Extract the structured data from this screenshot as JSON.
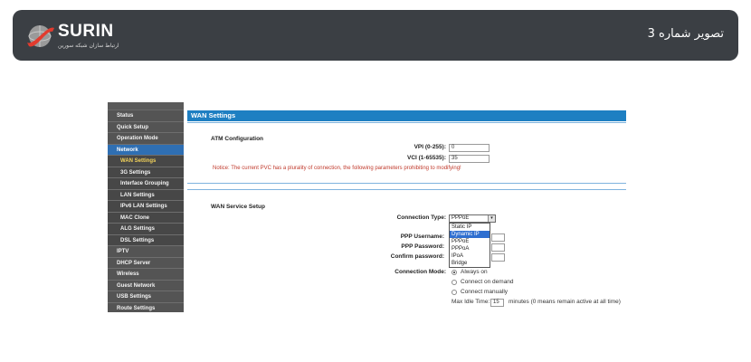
{
  "banner": {
    "brand": "SURIN",
    "tagline": "ارتباط سازان شبکه سورین",
    "title": "تصویر شماره 3"
  },
  "sidebar": {
    "items": [
      {
        "label": "Status",
        "level": "top"
      },
      {
        "label": "Quick Setup",
        "level": "top"
      },
      {
        "label": "Operation Mode",
        "level": "top"
      },
      {
        "label": "Network",
        "level": "active"
      },
      {
        "label": "WAN Settings",
        "level": "selected"
      },
      {
        "label": "3G Settings",
        "level": "sub"
      },
      {
        "label": "Interface Grouping",
        "level": "sub"
      },
      {
        "label": "LAN Settings",
        "level": "sub"
      },
      {
        "label": "IPv6 LAN Settings",
        "level": "sub"
      },
      {
        "label": "MAC Clone",
        "level": "sub"
      },
      {
        "label": "ALG Settings",
        "level": "sub"
      },
      {
        "label": "DSL Settings",
        "level": "sub"
      },
      {
        "label": "IPTV",
        "level": "top"
      },
      {
        "label": "DHCP Server",
        "level": "top"
      },
      {
        "label": "Wireless",
        "level": "top"
      },
      {
        "label": "Guest Network",
        "level": "top"
      },
      {
        "label": "USB Settings",
        "level": "top"
      },
      {
        "label": "Route Settings",
        "level": "top"
      }
    ]
  },
  "page": {
    "header": "WAN Settings",
    "atm": {
      "title": "ATM Configuration",
      "vpi_label": "VPI (0-255):",
      "vpi_value": "0",
      "vci_label": "VCI (1-65535):",
      "vci_value": "35",
      "notice": "Notice: The current PVC has a plurality of connection, the following parameters prohibiting to modifying!"
    },
    "wan": {
      "title": "WAN Service Setup",
      "conn_type_label": "Connection Type:",
      "conn_type_value": "PPPoE",
      "options": [
        "Static IP",
        "Dynamic IP",
        "PPPoE",
        "PPPoA",
        "IPoA",
        "Bridge"
      ],
      "highlighted_option": "Dynamic IP",
      "ppp_username_label": "PPP Username:",
      "ppp_password_label": "PPP Password:",
      "confirm_password_label": "Confirm password:",
      "conn_mode_label": "Connection Mode:",
      "modes": [
        "Always on",
        "Connect on demand",
        "Connect manually"
      ],
      "selected_mode": "Always on",
      "idle_label": "Max Idle Time:",
      "idle_value": "15",
      "idle_hint": "minutes (0 means remain active at all time)"
    }
  },
  "colors": {
    "banner_bg": "#3b3f44",
    "header_blue": "#1e7fc2",
    "sidebar_bg": "#4d4d4d",
    "notice_red": "#c0392b",
    "highlight_blue": "#2f6fd0"
  }
}
